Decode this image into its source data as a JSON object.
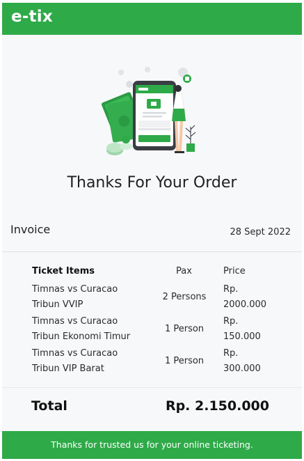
{
  "header": {
    "brand": "e-tix",
    "color": "#2eaa48"
  },
  "hero": {
    "illustration": "payment-phone-illustration",
    "title": "Thanks For Your Order"
  },
  "invoice": {
    "label": "Invoice",
    "date": "28 Sept 2022"
  },
  "table": {
    "headers": {
      "item": "Ticket Items",
      "pax": "Pax",
      "price": "Price"
    },
    "rows": [
      {
        "line1": "Timnas vs Curacao",
        "line2": "Tribun VVIP",
        "pax": "2 Persons",
        "currency": "Rp.",
        "amount": "2000.000"
      },
      {
        "line1": "Timnas vs Curacao",
        "line2": "Tribun Ekonomi Timur",
        "pax": "1 Person",
        "currency": "Rp.",
        "amount": "150.000"
      },
      {
        "line1": "Timnas vs Curacao",
        "line2": "Tribun VIP Barat",
        "pax": "1 Person",
        "currency": "Rp.",
        "amount": "300.000"
      }
    ]
  },
  "total": {
    "label": "Total",
    "value": "Rp. 2.150.000"
  },
  "footer": {
    "text": "Thanks for trusted us for your online ticketing."
  }
}
